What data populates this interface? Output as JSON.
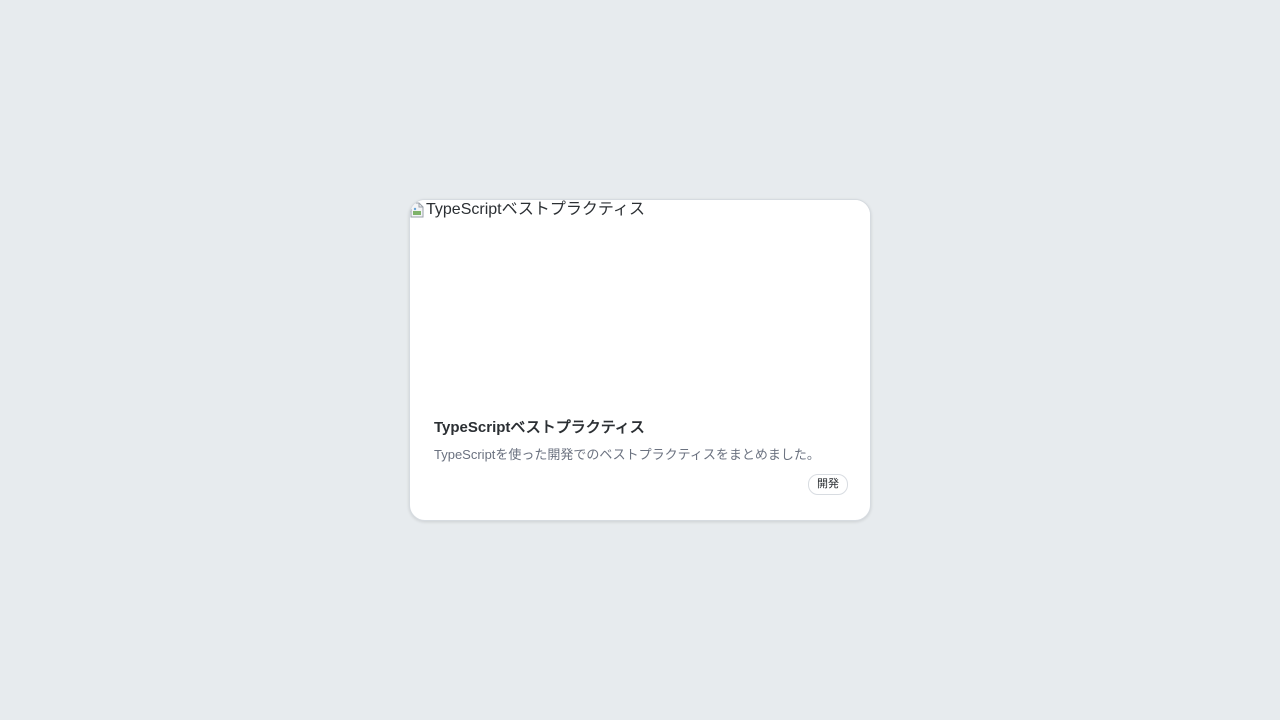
{
  "card": {
    "image_alt": "TypeScriptベストプラクティス",
    "title": "TypeScriptベストプラクティス",
    "description": "TypeScriptを使った開発でのベストプラクティスをまとめました。",
    "tags": [
      "開発"
    ],
    "broken_image_icon": "broken-image-icon"
  },
  "colors": {
    "background": "#e7ebee",
    "card": "#ffffff",
    "title": "#2b2f33",
    "description": "#6b7280"
  }
}
